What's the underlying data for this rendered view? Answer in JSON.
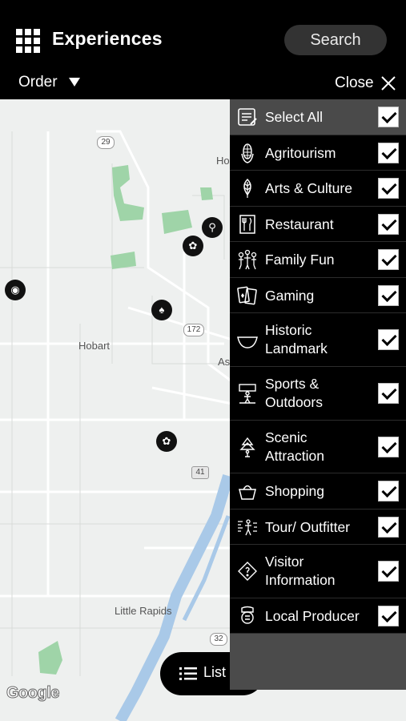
{
  "header": {
    "title": "Experiences",
    "search_label": "Search",
    "order_label": "Order",
    "close_label": "Close"
  },
  "map": {
    "labels": {
      "hobart": "Hobart",
      "little_rapids": "Little Rapids",
      "ho": "Ho",
      "as": "As"
    },
    "shields": {
      "r29": "29",
      "r172": "172",
      "r41": "41",
      "r32": "32"
    },
    "attribution": "Google",
    "list_button_label": "List"
  },
  "filters": {
    "select_all": "Select All",
    "items": [
      {
        "label": "Agritourism",
        "icon": "corn-icon",
        "checked": true
      },
      {
        "label": "Arts & Culture",
        "icon": "leaf-icon",
        "checked": true
      },
      {
        "label": "Restaurant",
        "icon": "utensils-icon",
        "checked": true
      },
      {
        "label": "Family Fun",
        "icon": "family-icon",
        "checked": true
      },
      {
        "label": "Gaming",
        "icon": "cards-icon",
        "checked": true
      },
      {
        "label": "Historic Landmark",
        "icon": "bowl-icon",
        "checked": true
      },
      {
        "label": "Sports & Outdoors",
        "icon": "hiker-icon",
        "checked": true
      },
      {
        "label": "Scenic Attraction",
        "icon": "tree-icon",
        "checked": true
      },
      {
        "label": "Shopping",
        "icon": "basket-icon",
        "checked": true
      },
      {
        "label": "Tour/ Outfitter",
        "icon": "binoculars-icon",
        "checked": true
      },
      {
        "label": "Visitor Information",
        "icon": "info-compass-icon",
        "checked": true
      },
      {
        "label": "Local Producer",
        "icon": "producer-icon",
        "checked": true
      }
    ]
  },
  "colors": {
    "header_bg": "#000000",
    "panel_bg": "#000000",
    "select_all_bg": "#4a4a4a",
    "map_bg": "#eef0ef",
    "park_green": "#9fd4a8",
    "river_blue": "#a9c9e8"
  }
}
